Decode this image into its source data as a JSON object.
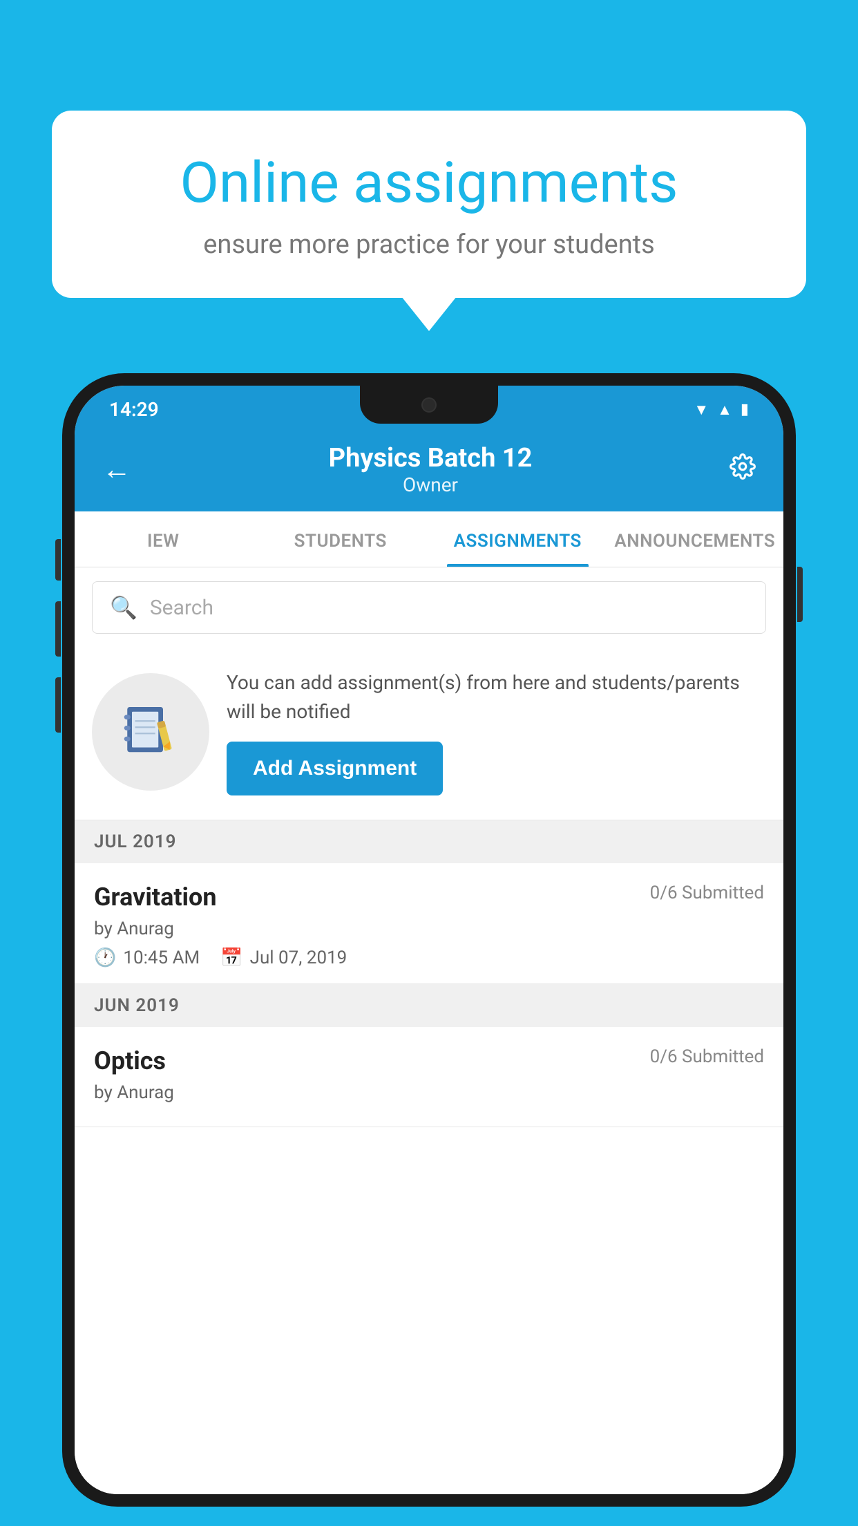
{
  "background_color": "#1ab6e8",
  "speech_bubble": {
    "heading": "Online assignments",
    "subtext": "ensure more practice for your students"
  },
  "status_bar": {
    "time": "14:29",
    "icons": [
      "wifi",
      "signal",
      "battery"
    ]
  },
  "app_header": {
    "title": "Physics Batch 12",
    "subtitle": "Owner",
    "back_label": "←",
    "settings_label": "⚙"
  },
  "tabs": [
    {
      "label": "IEW",
      "active": false
    },
    {
      "label": "STUDENTS",
      "active": false
    },
    {
      "label": "ASSIGNMENTS",
      "active": true
    },
    {
      "label": "ANNOUNCEMENTS",
      "active": false
    }
  ],
  "search": {
    "placeholder": "Search"
  },
  "add_assignment_promo": {
    "description": "You can add assignment(s) from here and students/parents will be notified",
    "button_label": "Add Assignment"
  },
  "sections": [
    {
      "label": "JUL 2019",
      "assignments": [
        {
          "name": "Gravitation",
          "submitted": "0/6 Submitted",
          "author": "by Anurag",
          "time": "10:45 AM",
          "date": "Jul 07, 2019"
        }
      ]
    },
    {
      "label": "JUN 2019",
      "assignments": [
        {
          "name": "Optics",
          "submitted": "0/6 Submitted",
          "author": "by Anurag",
          "time": "",
          "date": ""
        }
      ]
    }
  ]
}
